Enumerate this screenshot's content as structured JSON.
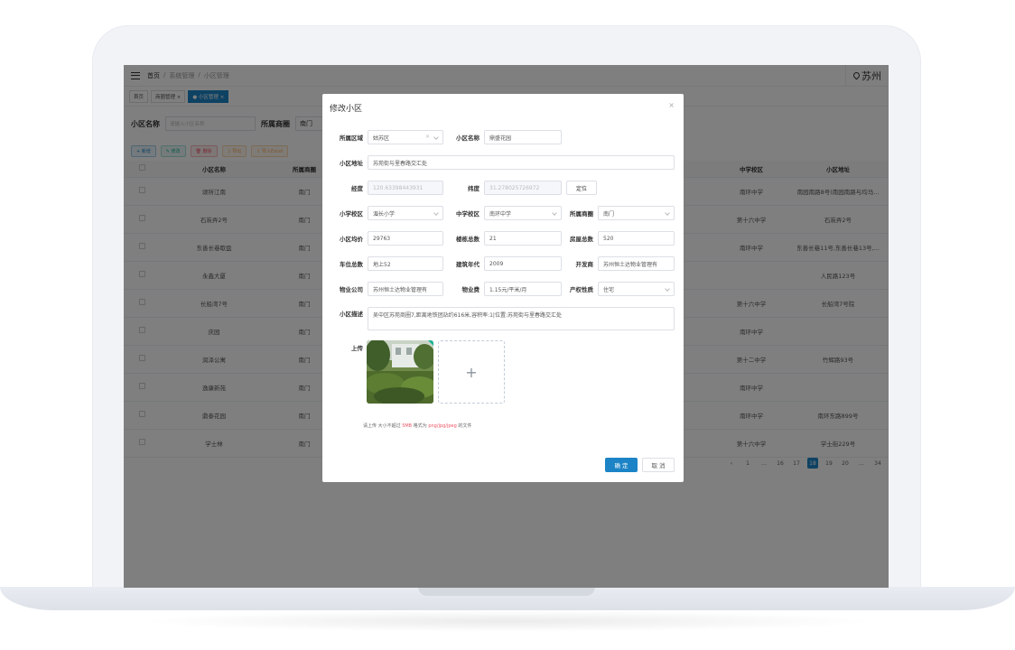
{
  "topbar": {
    "breadcrumb_home": "首页",
    "breadcrumb_sep": "/",
    "breadcrumb_section": "系统管理",
    "breadcrumb_page": "小区管理",
    "city": "苏州"
  },
  "tabs": [
    {
      "label": "首页"
    },
    {
      "label": "商圈管理 ×"
    },
    {
      "label": "● 小区管理 ×"
    }
  ],
  "filter": {
    "name_label": "小区名称",
    "name_placeholder": "请输入小区名称",
    "district_label": "所属商圈",
    "district_value": "南门"
  },
  "actions": {
    "new": "+ 新增",
    "edit": "✎ 修改",
    "delete": "🗑 删除",
    "export": "⇩ 导出",
    "import": "⇧ 导入Excel"
  },
  "table": {
    "headers": [
      "小区名称",
      "所属商圈",
      "中学校区",
      "小区地址"
    ],
    "rows": [
      {
        "name": "颂所江南",
        "district": "南门",
        "school": "南环中学",
        "address": "南园南路8号(南园南路与均马..."
      },
      {
        "name": "石炭弄2号",
        "district": "南门",
        "school": "第十六中学",
        "address": "石炭弄2号"
      },
      {
        "name": "东善长巷歇盘",
        "district": "南门",
        "school": "南环中学",
        "address": "东善长巷11号,东善长巷13号,..."
      },
      {
        "name": "永鑫大厦",
        "district": "南门",
        "school": "",
        "address": "人民路123号"
      },
      {
        "name": "长船湾7号",
        "district": "南门",
        "school": "第十六中学",
        "address": "长船湾7号院"
      },
      {
        "name": "庆园",
        "district": "南门",
        "school": "南环中学",
        "address": ""
      },
      {
        "name": "润泽公寓",
        "district": "南门",
        "school": "第十二中学",
        "address": "竹辉路93号"
      },
      {
        "name": "逸康新苑",
        "district": "南门",
        "school": "南环中学",
        "address": ""
      },
      {
        "name": "鼎泰花园",
        "district": "南门",
        "school": "南环中学",
        "address": "南环东路899号"
      },
      {
        "name": "学士林",
        "district": "南门",
        "school": "第十六中学",
        "address": "学士街229号"
      }
    ]
  },
  "pagination": {
    "prev": "‹",
    "pages": [
      "1",
      "…",
      "16",
      "17",
      "18",
      "19",
      "20",
      "…",
      "34"
    ],
    "current": "18"
  },
  "dialog": {
    "title": "修改小区",
    "close": "×",
    "area_label": "所属区域",
    "area_value": "姑苏区",
    "name_label": "小区名称",
    "name_value": "鼎盛花园",
    "address_label": "小区地址",
    "address_value": "苏苑街与里春路交汇处",
    "lng_label": "经度",
    "lng_value": "120.63398443931",
    "lat_label": "纬度",
    "lat_value": "31.278025726972",
    "locate_label": "定位",
    "primary_label": "小学校区",
    "primary_value": "湄长小学",
    "middle_label": "中学校区",
    "middle_value": "南环中学",
    "district_label": "所属商圈",
    "district_value": "南门",
    "price_label": "小区均价",
    "price_value": "29763",
    "buildings_label": "楼栋总数",
    "buildings_value": "21",
    "houses_label": "房屋总数",
    "houses_value": "520",
    "parking_label": "车位总数",
    "parking_value": "地上52",
    "year_label": "建筑年代",
    "year_value": "2009",
    "developer_label": "开发商",
    "developer_value": "苏州恒土达物业管理有",
    "property_label": "物业公司",
    "property_value": "苏州恒土达物业管理有",
    "fee_label": "物业费",
    "fee_value": "1.15元/平米/月",
    "ownership_label": "产权性质",
    "ownership_value": "住宅",
    "desc_label": "小区描述",
    "desc_value": "吴中区苏苑商圈7,距离地铁团站约616米,容积率:1|位置:苏苑街与里春路交汇处",
    "upload_label": "上传",
    "upload_add": "+",
    "tip_prefix": "请上传 大小不超过",
    "tip_size": "5MB",
    "tip_mid": "格式为",
    "tip_formats": "png/jpg/jpeg",
    "tip_suffix": "的文件",
    "ok": "确 定",
    "cancel": "取 消"
  }
}
